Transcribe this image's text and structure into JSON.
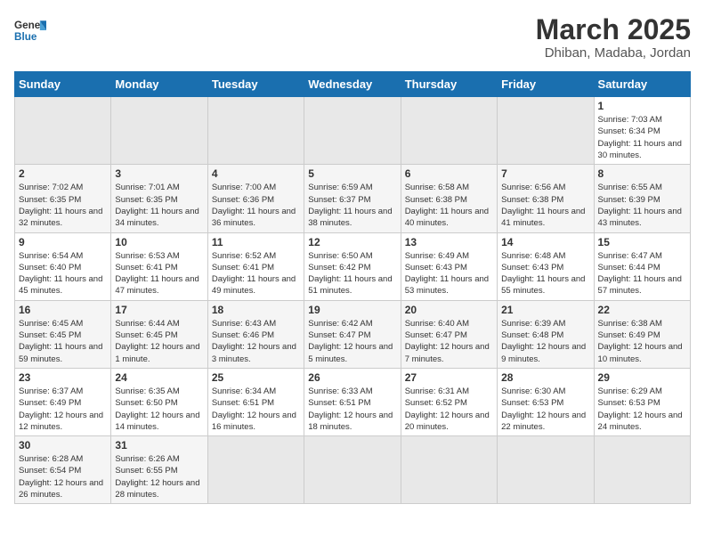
{
  "header": {
    "logo_general": "General",
    "logo_blue": "Blue",
    "month_title": "March 2025",
    "subtitle": "Dhiban, Madaba, Jordan"
  },
  "days_of_week": [
    "Sunday",
    "Monday",
    "Tuesday",
    "Wednesday",
    "Thursday",
    "Friday",
    "Saturday"
  ],
  "weeks": [
    [
      {
        "day": "",
        "info": ""
      },
      {
        "day": "",
        "info": ""
      },
      {
        "day": "",
        "info": ""
      },
      {
        "day": "",
        "info": ""
      },
      {
        "day": "",
        "info": ""
      },
      {
        "day": "",
        "info": ""
      },
      {
        "day": "1",
        "info": "Sunrise: 7:03 AM\nSunset: 6:34 PM\nDaylight: 11 hours and 30 minutes."
      }
    ],
    [
      {
        "day": "2",
        "info": "Sunrise: 7:02 AM\nSunset: 6:35 PM\nDaylight: 11 hours and 32 minutes."
      },
      {
        "day": "3",
        "info": "Sunrise: 7:01 AM\nSunset: 6:35 PM\nDaylight: 11 hours and 34 minutes."
      },
      {
        "day": "4",
        "info": "Sunrise: 7:00 AM\nSunset: 6:36 PM\nDaylight: 11 hours and 36 minutes."
      },
      {
        "day": "5",
        "info": "Sunrise: 6:59 AM\nSunset: 6:37 PM\nDaylight: 11 hours and 38 minutes."
      },
      {
        "day": "6",
        "info": "Sunrise: 6:58 AM\nSunset: 6:38 PM\nDaylight: 11 hours and 40 minutes."
      },
      {
        "day": "7",
        "info": "Sunrise: 6:56 AM\nSunset: 6:38 PM\nDaylight: 11 hours and 41 minutes."
      },
      {
        "day": "8",
        "info": "Sunrise: 6:55 AM\nSunset: 6:39 PM\nDaylight: 11 hours and 43 minutes."
      }
    ],
    [
      {
        "day": "9",
        "info": "Sunrise: 6:54 AM\nSunset: 6:40 PM\nDaylight: 11 hours and 45 minutes."
      },
      {
        "day": "10",
        "info": "Sunrise: 6:53 AM\nSunset: 6:41 PM\nDaylight: 11 hours and 47 minutes."
      },
      {
        "day": "11",
        "info": "Sunrise: 6:52 AM\nSunset: 6:41 PM\nDaylight: 11 hours and 49 minutes."
      },
      {
        "day": "12",
        "info": "Sunrise: 6:50 AM\nSunset: 6:42 PM\nDaylight: 11 hours and 51 minutes."
      },
      {
        "day": "13",
        "info": "Sunrise: 6:49 AM\nSunset: 6:43 PM\nDaylight: 11 hours and 53 minutes."
      },
      {
        "day": "14",
        "info": "Sunrise: 6:48 AM\nSunset: 6:43 PM\nDaylight: 11 hours and 55 minutes."
      },
      {
        "day": "15",
        "info": "Sunrise: 6:47 AM\nSunset: 6:44 PM\nDaylight: 11 hours and 57 minutes."
      }
    ],
    [
      {
        "day": "16",
        "info": "Sunrise: 6:45 AM\nSunset: 6:45 PM\nDaylight: 11 hours and 59 minutes."
      },
      {
        "day": "17",
        "info": "Sunrise: 6:44 AM\nSunset: 6:45 PM\nDaylight: 12 hours and 1 minute."
      },
      {
        "day": "18",
        "info": "Sunrise: 6:43 AM\nSunset: 6:46 PM\nDaylight: 12 hours and 3 minutes."
      },
      {
        "day": "19",
        "info": "Sunrise: 6:42 AM\nSunset: 6:47 PM\nDaylight: 12 hours and 5 minutes."
      },
      {
        "day": "20",
        "info": "Sunrise: 6:40 AM\nSunset: 6:47 PM\nDaylight: 12 hours and 7 minutes."
      },
      {
        "day": "21",
        "info": "Sunrise: 6:39 AM\nSunset: 6:48 PM\nDaylight: 12 hours and 9 minutes."
      },
      {
        "day": "22",
        "info": "Sunrise: 6:38 AM\nSunset: 6:49 PM\nDaylight: 12 hours and 10 minutes."
      }
    ],
    [
      {
        "day": "23",
        "info": "Sunrise: 6:37 AM\nSunset: 6:49 PM\nDaylight: 12 hours and 12 minutes."
      },
      {
        "day": "24",
        "info": "Sunrise: 6:35 AM\nSunset: 6:50 PM\nDaylight: 12 hours and 14 minutes."
      },
      {
        "day": "25",
        "info": "Sunrise: 6:34 AM\nSunset: 6:51 PM\nDaylight: 12 hours and 16 minutes."
      },
      {
        "day": "26",
        "info": "Sunrise: 6:33 AM\nSunset: 6:51 PM\nDaylight: 12 hours and 18 minutes."
      },
      {
        "day": "27",
        "info": "Sunrise: 6:31 AM\nSunset: 6:52 PM\nDaylight: 12 hours and 20 minutes."
      },
      {
        "day": "28",
        "info": "Sunrise: 6:30 AM\nSunset: 6:53 PM\nDaylight: 12 hours and 22 minutes."
      },
      {
        "day": "29",
        "info": "Sunrise: 6:29 AM\nSunset: 6:53 PM\nDaylight: 12 hours and 24 minutes."
      }
    ],
    [
      {
        "day": "30",
        "info": "Sunrise: 6:28 AM\nSunset: 6:54 PM\nDaylight: 12 hours and 26 minutes."
      },
      {
        "day": "31",
        "info": "Sunrise: 6:26 AM\nSunset: 6:55 PM\nDaylight: 12 hours and 28 minutes."
      },
      {
        "day": "",
        "info": ""
      },
      {
        "day": "",
        "info": ""
      },
      {
        "day": "",
        "info": ""
      },
      {
        "day": "",
        "info": ""
      },
      {
        "day": "",
        "info": ""
      }
    ]
  ]
}
